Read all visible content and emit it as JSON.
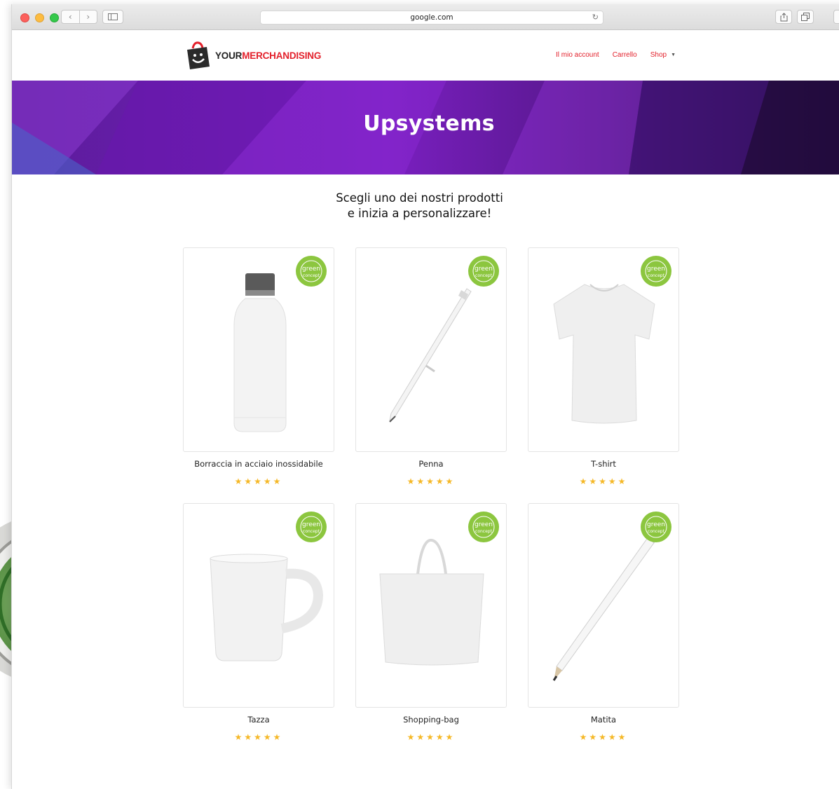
{
  "browser": {
    "url": "google.com",
    "icons": {
      "back": "chevron-left-icon",
      "forward": "chevron-right-icon",
      "sidebar": "sidebar-icon",
      "reload": "reload-icon",
      "share": "share-icon",
      "tabs": "tabs-icon"
    },
    "glyphs": {
      "back": "‹",
      "forward": "›",
      "reload": "↻"
    }
  },
  "header": {
    "logo_your": "YOUR",
    "logo_merch": "MERCHANDISING",
    "nav": {
      "account": "Il mio account",
      "cart": "Carrello",
      "shop": "Shop",
      "shop_caret": "▼"
    }
  },
  "hero": {
    "title": "Upsystems"
  },
  "intro": {
    "line1": "Scegli uno dei nostri prodotti",
    "line2": "e inizia a personalizzare!"
  },
  "badge": {
    "text": "green",
    "text2": "concept"
  },
  "products": [
    {
      "name": "Borraccia in acciaio inossidabile",
      "stars": "★★★★★",
      "rating": 5,
      "icon": "bottle-image"
    },
    {
      "name": "Penna",
      "stars": "★★★★★",
      "rating": 5,
      "icon": "pen-image"
    },
    {
      "name": "T-shirt",
      "stars": "★★★★★",
      "rating": 5,
      "icon": "tshirt-image"
    },
    {
      "name": "Tazza",
      "stars": "★★★★★",
      "rating": 5,
      "icon": "mug-image"
    },
    {
      "name": "Shopping-bag",
      "stars": "★★★★★",
      "rating": 5,
      "icon": "bag-image"
    },
    {
      "name": "Matita",
      "stars": "★★★★★",
      "rating": 5,
      "icon": "pencil-image"
    }
  ],
  "colors": {
    "accent": "#e3212c",
    "hero": "#6a1ab0",
    "stars": "#f5b827",
    "badge": "#8cc63f"
  }
}
